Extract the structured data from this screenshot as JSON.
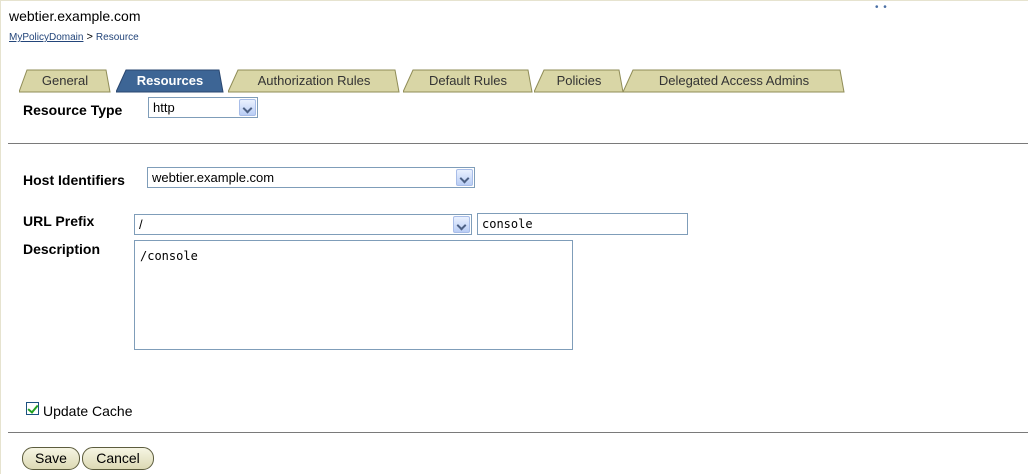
{
  "header": {
    "title": "webtier.example.com",
    "corner_mark": "• •"
  },
  "breadcrumb": {
    "link": "MyPolicyDomain",
    "separator": ">",
    "current": "Resource"
  },
  "tabs": [
    {
      "label": "General",
      "active": false
    },
    {
      "label": "Resources",
      "active": true
    },
    {
      "label": "Authorization Rules",
      "active": false
    },
    {
      "label": "Default Rules",
      "active": false
    },
    {
      "label": "Policies",
      "active": false
    },
    {
      "label": "Delegated Access Admins",
      "active": false
    }
  ],
  "colors": {
    "tab_inactive": "#d9d6a6",
    "tab_active": "#3d6595",
    "tab_border": "#8f8c57"
  },
  "form": {
    "resource_type_label": "Resource Type",
    "resource_type_value": "http",
    "host_identifiers_label": "Host Identifiers",
    "host_identifiers_value": "webtier.example.com",
    "url_prefix_label": "URL Prefix",
    "url_prefix_select": "/",
    "url_prefix_input": "console",
    "description_label": "Description",
    "description_value": "/console",
    "update_cache_label": "Update Cache",
    "update_cache_checked": true
  },
  "buttons": {
    "save": "Save",
    "cancel": "Cancel"
  }
}
